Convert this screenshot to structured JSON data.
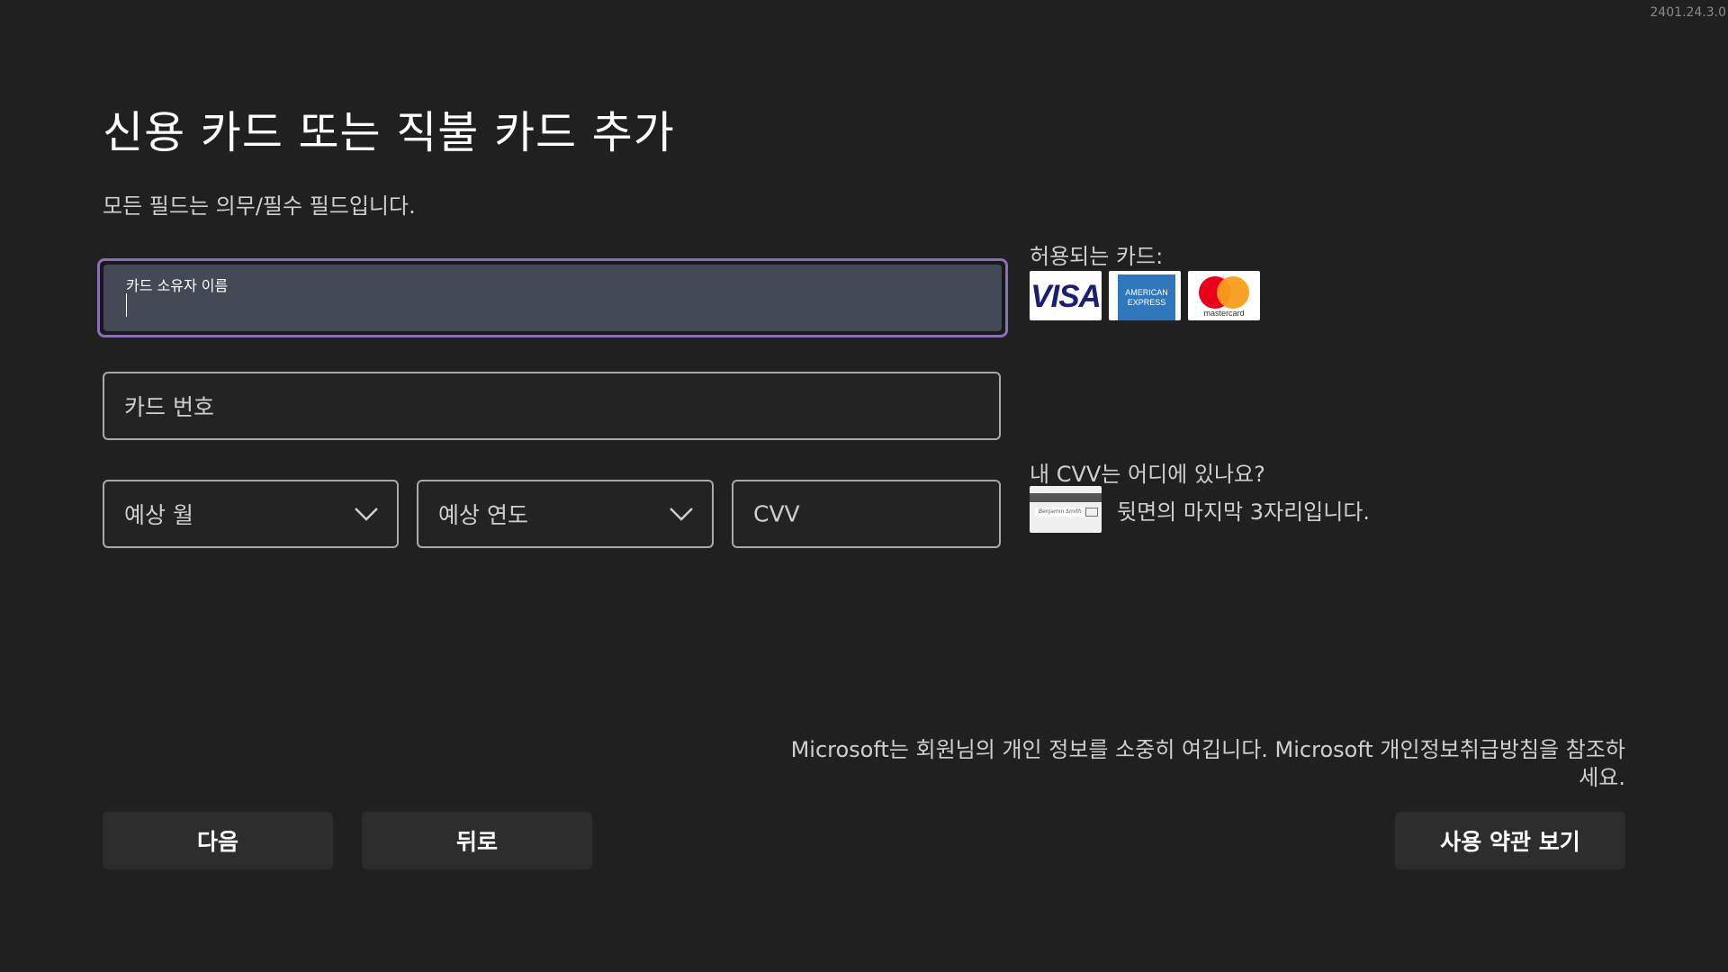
{
  "version": "2401.24.3.0",
  "title": "신용 카드 또는 직불 카드 추가",
  "subtitle": "모든 필드는 의무/필수 필드입니다.",
  "form": {
    "cardholder_label": "카드 소유자 이름",
    "cardholder_value": "",
    "card_number_placeholder": "카드 번호",
    "exp_month_placeholder": "예상 월",
    "exp_year_placeholder": "예상 연도",
    "cvv_placeholder": "CVV"
  },
  "accepted_cards": {
    "label": "허용되는 카드:",
    "visa": "VISA",
    "amex_line1": "AMERICAN",
    "amex_line2": "EXPRESS",
    "mastercard": "mastercard"
  },
  "cvv_help": {
    "question": "내 CVV는 어디에 있나요?",
    "description": "뒷면의 마지막 3자리입니다.",
    "sample_signature": "Benjamin Smith"
  },
  "privacy_text": "Microsoft는 회원님의 개인 정보를 소중히 여깁니다. Microsoft 개인정보취급방침을 참조하세요.",
  "buttons": {
    "next": "다음",
    "back": "뒤로",
    "terms": "사용 약관 보기"
  },
  "colors": {
    "background": "#202020",
    "focus_border": "#8a6fb8",
    "active_field_fill": "#444a55",
    "button_bg": "#2d2d2d"
  },
  "icons": [
    "chevron-down-icon",
    "visa-logo-icon",
    "amex-logo-icon",
    "mastercard-logo-icon",
    "cvv-card-icon"
  ]
}
